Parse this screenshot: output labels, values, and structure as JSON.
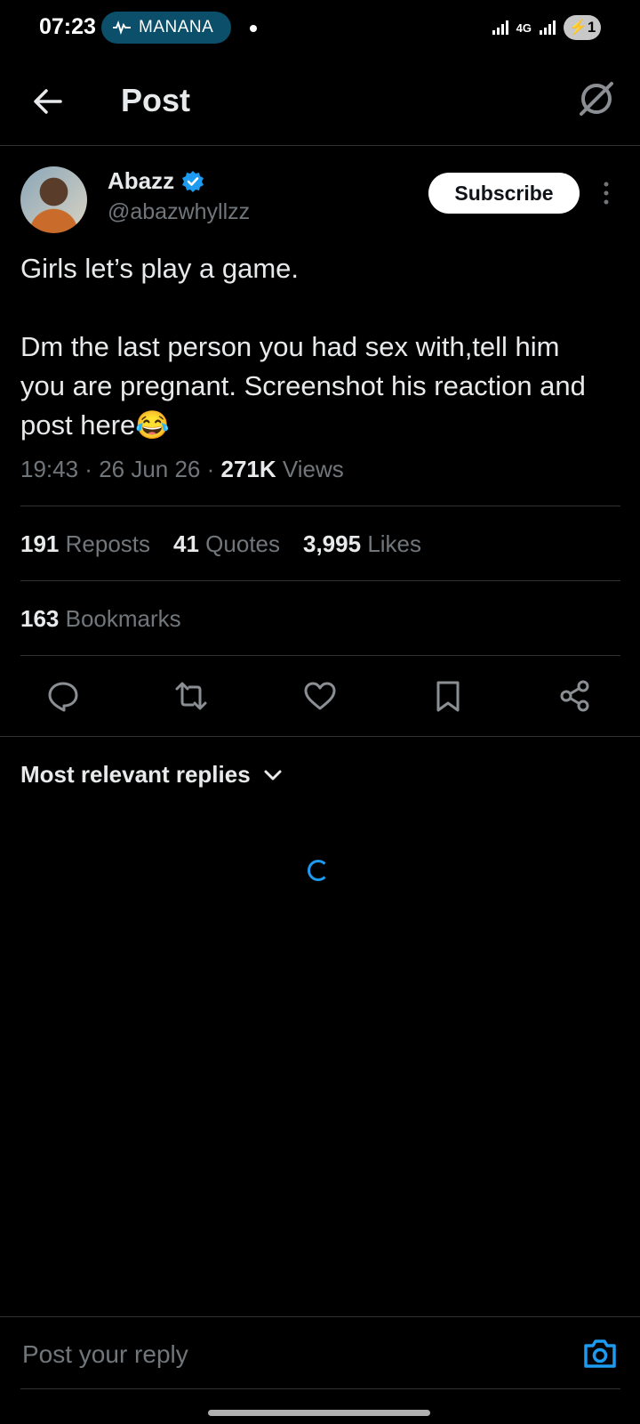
{
  "status": {
    "time": "07:23",
    "pill_label": "MANANA",
    "network": "4G",
    "battery": "1"
  },
  "header": {
    "title": "Post"
  },
  "post": {
    "author_name": "Abazz",
    "handle": "@abazwhyllzz",
    "subscribe_label": "Subscribe",
    "text": "Girls let’s play a game.\n\nDm the last person you had sex with,tell him you are pregnant. Screenshot his reaction and post here😂",
    "time": "19:43",
    "date": "26 Jun 26",
    "views_count": "271K",
    "views_label": "Views"
  },
  "stats": {
    "reposts_count": "191",
    "reposts_label": "Reposts",
    "quotes_count": "41",
    "quotes_label": "Quotes",
    "likes_count": "3,995",
    "likes_label": "Likes",
    "bookmarks_count": "163",
    "bookmarks_label": "Bookmarks"
  },
  "replies": {
    "sort_label": "Most relevant replies"
  },
  "reply_bar": {
    "placeholder": "Post your reply"
  },
  "colors": {
    "accent": "#1d9bf0",
    "background": "#000000",
    "text": "#e7e9ea",
    "muted": "#71767b"
  }
}
